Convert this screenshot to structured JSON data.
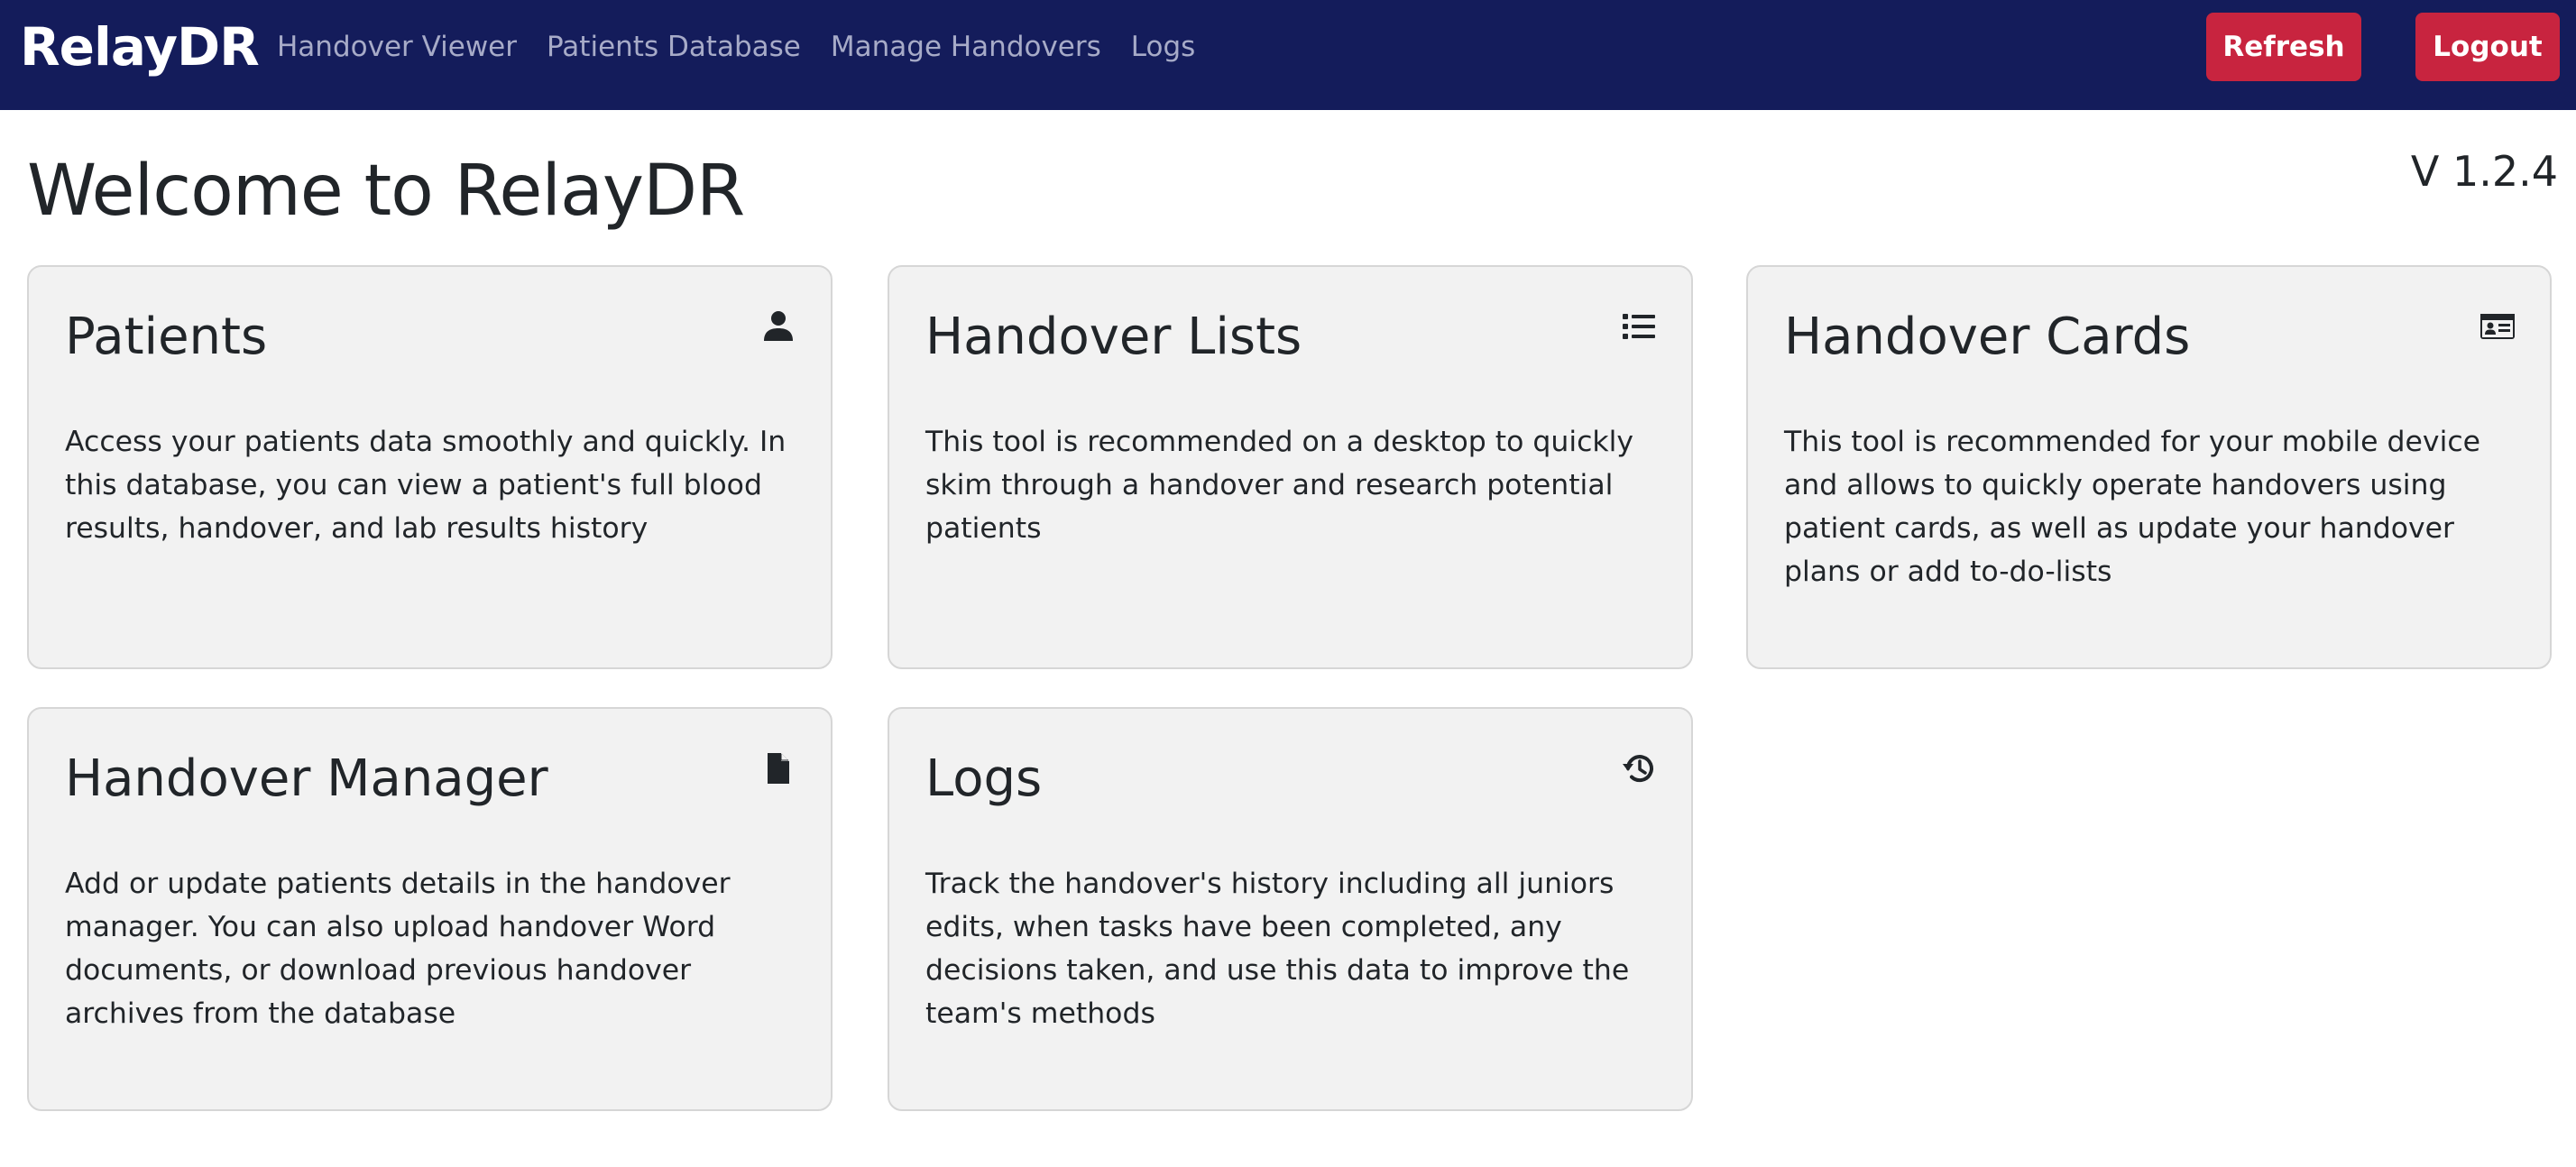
{
  "navbar": {
    "brand": "RelayDR",
    "links": [
      "Handover Viewer",
      "Patients Database",
      "Manage Handovers",
      "Logs"
    ],
    "refresh_label": "Refresh",
    "logout_label": "Logout",
    "background_color": "#141c5b",
    "button_color": "#c8243f"
  },
  "main": {
    "title": "Welcome to RelayDR",
    "version": "V 1.2.4"
  },
  "cards": [
    {
      "title": "Patients",
      "icon": "person-icon",
      "text": "Access your patients data smoothly and quickly. In this database, you can view a patient's full blood results, handover, and lab results history"
    },
    {
      "title": "Handover Lists",
      "icon": "list-icon",
      "text": "This tool is recommended on a desktop to quickly skim through a handover and research potential patients"
    },
    {
      "title": "Handover Cards",
      "icon": "id-card-icon",
      "text": "This tool is recommended for your mobile device and allows to quickly operate handovers using patient cards, as well as update your handover plans or add to-do-lists"
    },
    {
      "title": "Handover Manager",
      "icon": "file-icon",
      "text": "Add or update patients details in the handover manager. You can also upload handover Word documents, or download previous handover archives from the database"
    },
    {
      "title": "Logs",
      "icon": "history-icon",
      "text": "Track the handover's history including all juniors edits, when tasks have been completed, any decisions taken, and use this data to improve the team's methods"
    }
  ]
}
